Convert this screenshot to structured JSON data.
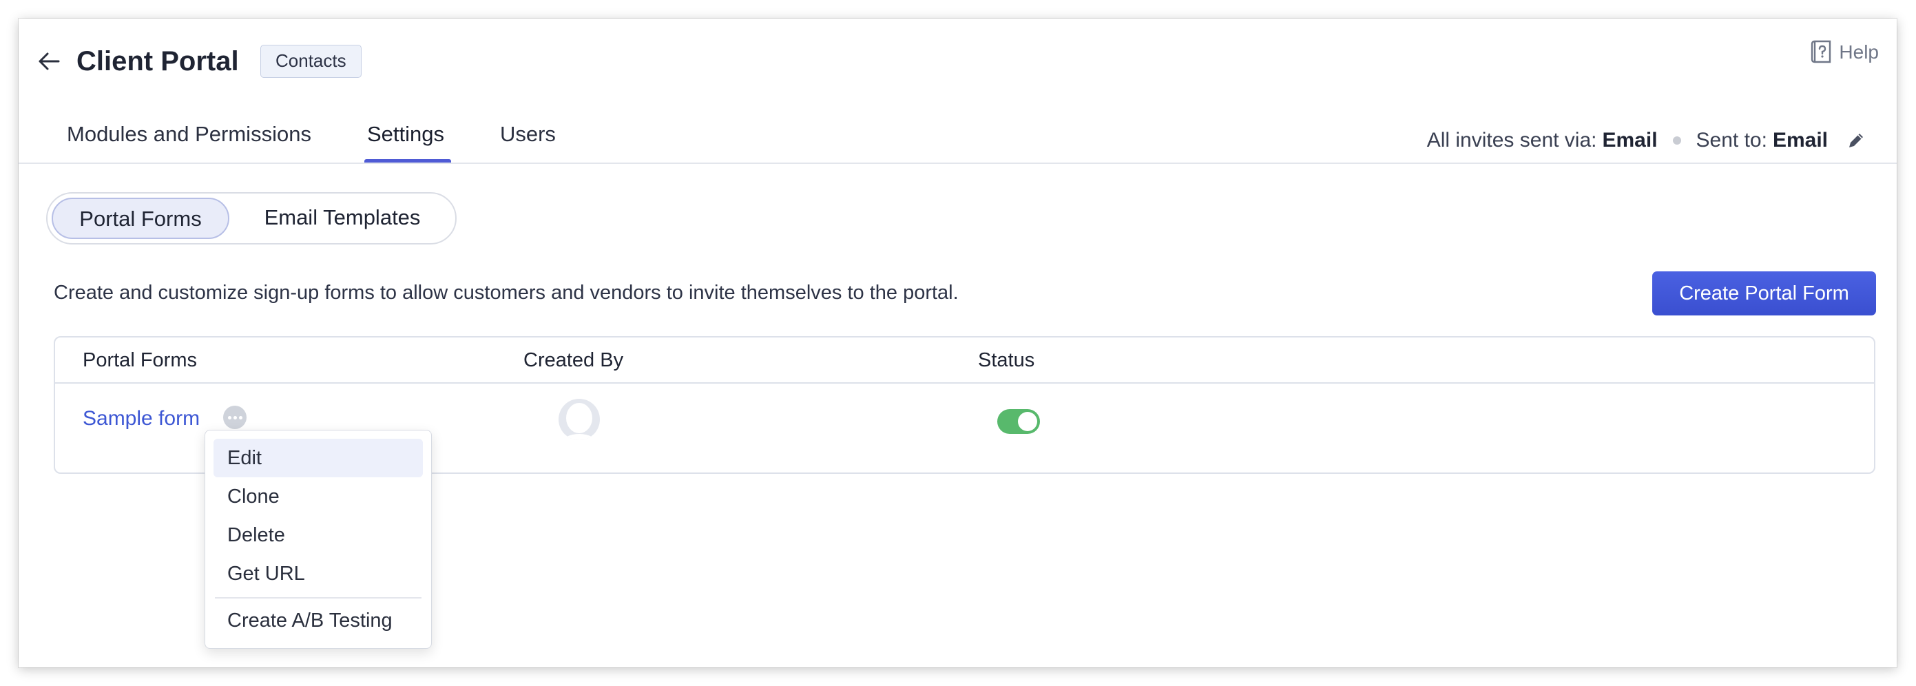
{
  "header": {
    "title": "Client Portal",
    "module_badge": "Contacts",
    "help_label": "Help"
  },
  "tabs": [
    {
      "label": "Modules and Permissions",
      "active": false
    },
    {
      "label": "Settings",
      "active": true
    },
    {
      "label": "Users",
      "active": false
    }
  ],
  "invites": {
    "via_label": "All invites sent via:",
    "via_value": "Email",
    "sent_to_label": "Sent to:",
    "sent_to_value": "Email"
  },
  "segment": {
    "active": "Portal Forms",
    "inactive": "Email Templates"
  },
  "description": "Create and customize sign-up forms to allow customers and vendors to invite themselves to the portal.",
  "create_button": "Create Portal Form",
  "table": {
    "columns": [
      "Portal Forms",
      "Created By",
      "Status"
    ],
    "rows": [
      {
        "name": "Sample form",
        "created_by": "avatar",
        "status": "enabled"
      }
    ]
  },
  "row_menu": {
    "items": [
      "Edit",
      "Clone",
      "Delete",
      "Get URL",
      "Create A/B Testing"
    ],
    "highlighted": "Edit"
  },
  "colors": {
    "accent": "#4f5bd5",
    "primary_button": "#3e55d8",
    "link": "#3d57d4",
    "toggle_on": "#58b96c"
  }
}
